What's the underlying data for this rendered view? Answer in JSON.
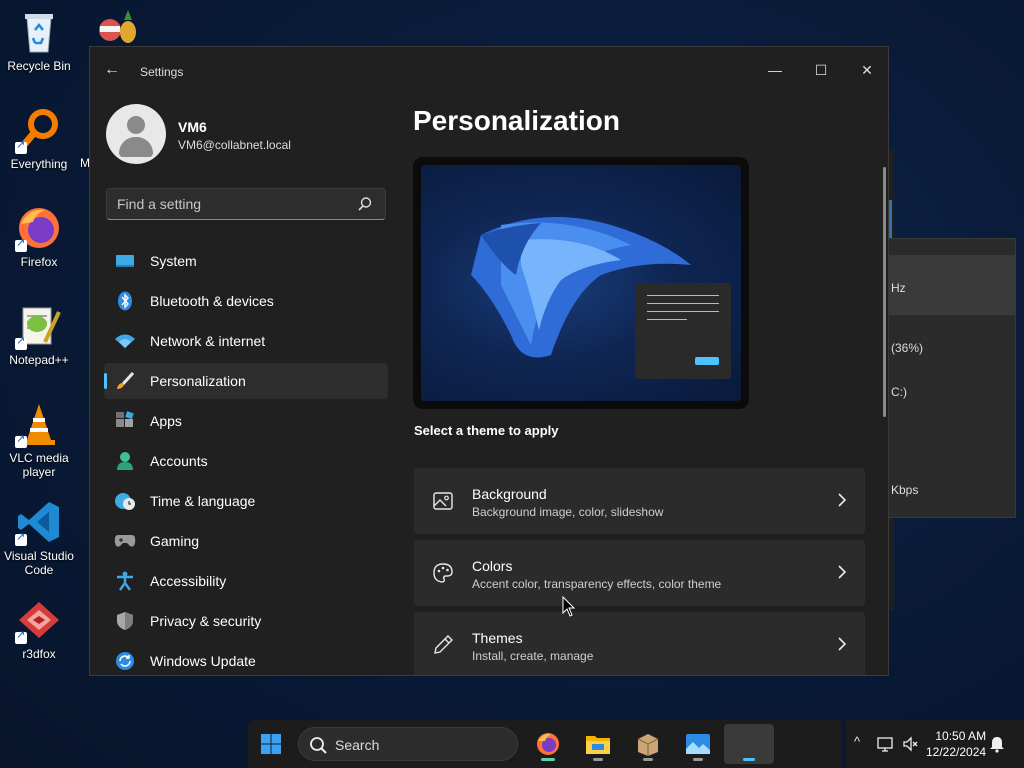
{
  "desktop": {
    "icons": [
      {
        "label": "Recycle Bin"
      },
      {
        "label": "Everything"
      },
      {
        "label": "Firefox"
      },
      {
        "label": "Notepad++"
      },
      {
        "label": "VLC media player"
      },
      {
        "label": "Visual Studio Code"
      },
      {
        "label": "r3dfox"
      }
    ],
    "partial_label": "M"
  },
  "bg_window": {
    "rows": [
      "Hz",
      "(36%)",
      "C:)",
      "Kbps"
    ]
  },
  "settings": {
    "title": "Settings",
    "back_glyph": "←",
    "controls": {
      "minimize": "—",
      "maximize": "☐",
      "close": "✕"
    },
    "user": {
      "name": "VM6",
      "email": "VM6@collabnet.local"
    },
    "search": {
      "placeholder": "Find a setting"
    },
    "nav": [
      {
        "label": "System",
        "icon": "system-icon"
      },
      {
        "label": "Bluetooth & devices",
        "icon": "bluetooth-icon"
      },
      {
        "label": "Network & internet",
        "icon": "wifi-icon"
      },
      {
        "label": "Personalization",
        "icon": "brush-icon",
        "active": true
      },
      {
        "label": "Apps",
        "icon": "apps-icon"
      },
      {
        "label": "Accounts",
        "icon": "accounts-icon"
      },
      {
        "label": "Time & language",
        "icon": "clock-globe-icon"
      },
      {
        "label": "Gaming",
        "icon": "gamepad-icon"
      },
      {
        "label": "Accessibility",
        "icon": "accessibility-icon"
      },
      {
        "label": "Privacy & security",
        "icon": "shield-icon"
      },
      {
        "label": "Windows Update",
        "icon": "update-icon"
      }
    ],
    "page_title": "Personalization",
    "theme_prompt": "Select a theme to apply",
    "cards": [
      {
        "title": "Background",
        "subtitle": "Background image, color, slideshow",
        "icon": "image-icon"
      },
      {
        "title": "Colors",
        "subtitle": "Accent color, transparency effects, color theme",
        "icon": "palette-icon"
      },
      {
        "title": "Themes",
        "subtitle": "Install, create, manage",
        "icon": "pen-icon"
      }
    ],
    "accent_color": "#4cc2ff"
  },
  "taskbar": {
    "search_label": "Search",
    "apps": [
      "Start",
      "Firefox",
      "File Explorer",
      "Archive manager",
      "Photos",
      "Settings"
    ],
    "tray": {
      "time": "10:50 AM",
      "date": "12/22/2024",
      "overflow_glyph": "^"
    }
  }
}
